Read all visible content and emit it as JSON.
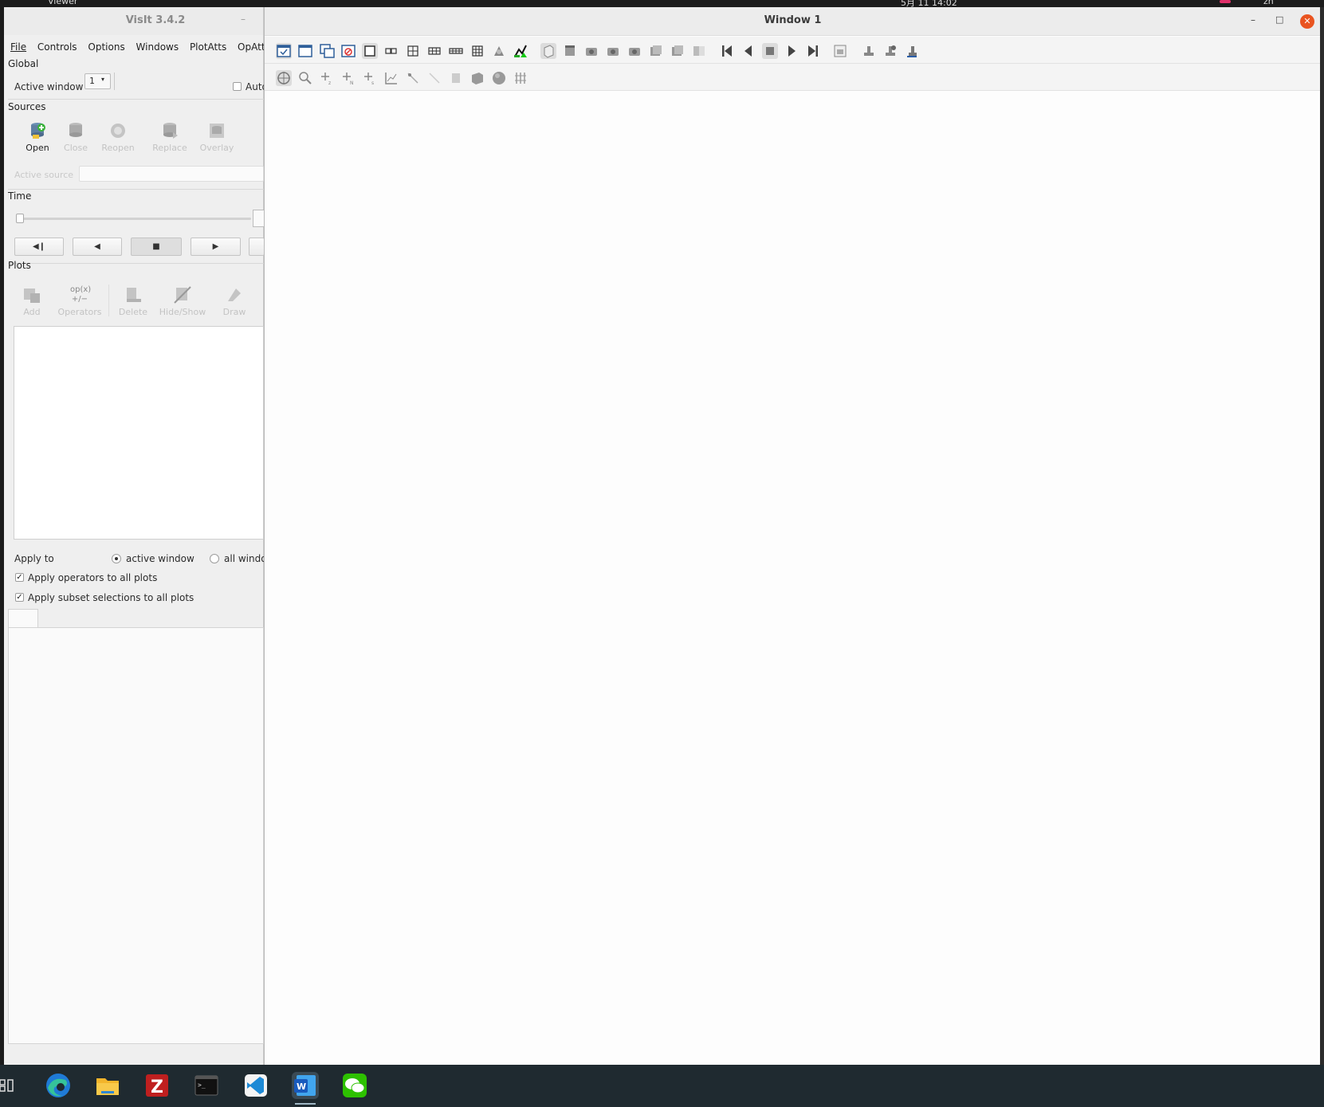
{
  "system_bar": {
    "left_text": "Viewer",
    "center_text": "5月 11  14:02",
    "right_text": "zh"
  },
  "main_window": {
    "title": "VisIt 3.4.2",
    "menu": [
      "File",
      "Controls",
      "Options",
      "Windows",
      "PlotAtts",
      "OpAtts"
    ],
    "global": {
      "label": "Global",
      "active_window_label": "Active window",
      "active_window_value": "1",
      "auto_label": "Auto"
    },
    "sources": {
      "label": "Sources",
      "buttons": [
        {
          "label": "Open",
          "icon": "open-database-icon",
          "enabled": true
        },
        {
          "label": "Close",
          "icon": "close-database-icon",
          "enabled": false
        },
        {
          "label": "Reopen",
          "icon": "reopen-database-icon",
          "enabled": false
        },
        {
          "label": "Replace",
          "icon": "replace-database-icon",
          "enabled": false
        },
        {
          "label": "Overlay",
          "icon": "overlay-database-icon",
          "enabled": false
        }
      ],
      "active_source_label": "Active source",
      "active_source_value": ""
    },
    "time": {
      "label": "Time",
      "buttons": [
        {
          "icon": "step-back-icon",
          "glyph": "◀❙"
        },
        {
          "icon": "play-backward-icon",
          "glyph": "◀"
        },
        {
          "icon": "stop-icon",
          "glyph": "■"
        },
        {
          "icon": "play-forward-icon",
          "glyph": "▶"
        }
      ]
    },
    "plots": {
      "label": "Plots",
      "buttons": [
        {
          "label": "Add",
          "icon": "add-plot-icon",
          "enabled": false
        },
        {
          "label": "Operators",
          "icon": "operators-icon",
          "enabled": false
        },
        {
          "label": "Delete",
          "icon": "delete-plot-icon",
          "enabled": false
        },
        {
          "label": "Hide/Show",
          "icon": "hide-show-icon",
          "enabled": false
        },
        {
          "label": "Draw",
          "icon": "draw-icon",
          "enabled": false
        }
      ],
      "apply_to_label": "Apply to",
      "apply_active": "active window",
      "apply_all": "all windows",
      "apply_operators": "Apply operators to all plots",
      "apply_subset": "Apply subset selections to all plots"
    }
  },
  "viewer": {
    "title": "Window 1",
    "toolbar1_icons": [
      "toggle-mode-icon",
      "new-window-icon",
      "clone-window-icon",
      "delete-window-icon",
      "layout-1x1-icon",
      "layout-1x2-icon",
      "layout-2x2-icon",
      "layout-2x3-icon",
      "layout-2x4-icon",
      "layout-3x3-icon",
      "lock-time-icon",
      "spinning-icon",
      "reset-view-icon",
      "recenter-view-icon",
      "undo-view-icon",
      "redo-view-icon",
      "save-view-icon",
      "choose-view-icon",
      "invert-bg-icon",
      "reverse-end-icon",
      "reverse-step-icon",
      "stop-anim-icon",
      "forward-step-icon",
      "forward-end-icon",
      "copy-attributes-icon",
      "lock-view-icon",
      "lock-tools-icon",
      "clear-icon"
    ],
    "toolbar2_icons": [
      "navigate-icon",
      "zoom-icon",
      "pick-zone-icon",
      "pick-node-icon",
      "pick-icon",
      "lineout-icon",
      "line-pick-icon",
      "line-icon",
      "box-tool-icon",
      "plane-tool-icon",
      "sphere-tool-icon",
      "point-tool-icon"
    ]
  },
  "taskbar": {
    "apps": [
      {
        "icon": "activities-icon"
      },
      {
        "icon": "edge-browser-icon"
      },
      {
        "icon": "files-icon"
      },
      {
        "icon": "filezilla-icon"
      },
      {
        "icon": "terminal-icon"
      },
      {
        "icon": "vscode-icon"
      },
      {
        "icon": "word-icon",
        "active": true
      },
      {
        "icon": "wechat-icon"
      }
    ]
  },
  "colors": {
    "close_button": "#e95420",
    "taskbar_bg": "#1f2a30",
    "panel_bg": "#efefef"
  }
}
